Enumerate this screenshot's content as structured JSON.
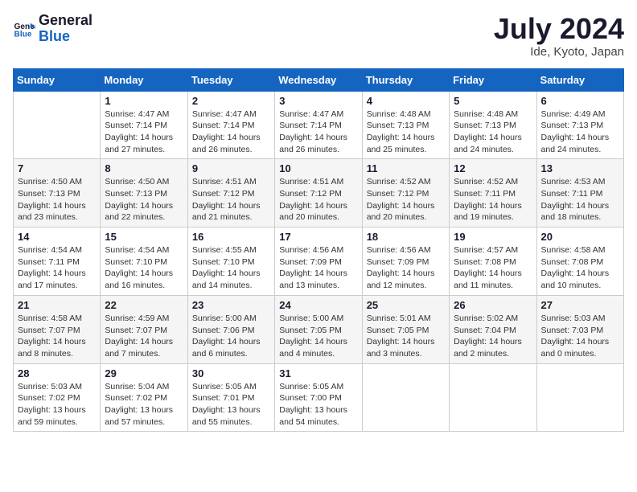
{
  "logo": {
    "line1": "General",
    "line2": "Blue"
  },
  "title": "July 2024",
  "location": "Ide, Kyoto, Japan",
  "header": {
    "days": [
      "Sunday",
      "Monday",
      "Tuesday",
      "Wednesday",
      "Thursday",
      "Friday",
      "Saturday"
    ]
  },
  "weeks": [
    [
      {
        "day": "",
        "info": ""
      },
      {
        "day": "1",
        "info": "Sunrise: 4:47 AM\nSunset: 7:14 PM\nDaylight: 14 hours\nand 27 minutes."
      },
      {
        "day": "2",
        "info": "Sunrise: 4:47 AM\nSunset: 7:14 PM\nDaylight: 14 hours\nand 26 minutes."
      },
      {
        "day": "3",
        "info": "Sunrise: 4:47 AM\nSunset: 7:14 PM\nDaylight: 14 hours\nand 26 minutes."
      },
      {
        "day": "4",
        "info": "Sunrise: 4:48 AM\nSunset: 7:13 PM\nDaylight: 14 hours\nand 25 minutes."
      },
      {
        "day": "5",
        "info": "Sunrise: 4:48 AM\nSunset: 7:13 PM\nDaylight: 14 hours\nand 24 minutes."
      },
      {
        "day": "6",
        "info": "Sunrise: 4:49 AM\nSunset: 7:13 PM\nDaylight: 14 hours\nand 24 minutes."
      }
    ],
    [
      {
        "day": "7",
        "info": "Sunrise: 4:50 AM\nSunset: 7:13 PM\nDaylight: 14 hours\nand 23 minutes."
      },
      {
        "day": "8",
        "info": "Sunrise: 4:50 AM\nSunset: 7:13 PM\nDaylight: 14 hours\nand 22 minutes."
      },
      {
        "day": "9",
        "info": "Sunrise: 4:51 AM\nSunset: 7:12 PM\nDaylight: 14 hours\nand 21 minutes."
      },
      {
        "day": "10",
        "info": "Sunrise: 4:51 AM\nSunset: 7:12 PM\nDaylight: 14 hours\nand 20 minutes."
      },
      {
        "day": "11",
        "info": "Sunrise: 4:52 AM\nSunset: 7:12 PM\nDaylight: 14 hours\nand 20 minutes."
      },
      {
        "day": "12",
        "info": "Sunrise: 4:52 AM\nSunset: 7:11 PM\nDaylight: 14 hours\nand 19 minutes."
      },
      {
        "day": "13",
        "info": "Sunrise: 4:53 AM\nSunset: 7:11 PM\nDaylight: 14 hours\nand 18 minutes."
      }
    ],
    [
      {
        "day": "14",
        "info": "Sunrise: 4:54 AM\nSunset: 7:11 PM\nDaylight: 14 hours\nand 17 minutes."
      },
      {
        "day": "15",
        "info": "Sunrise: 4:54 AM\nSunset: 7:10 PM\nDaylight: 14 hours\nand 16 minutes."
      },
      {
        "day": "16",
        "info": "Sunrise: 4:55 AM\nSunset: 7:10 PM\nDaylight: 14 hours\nand 14 minutes."
      },
      {
        "day": "17",
        "info": "Sunrise: 4:56 AM\nSunset: 7:09 PM\nDaylight: 14 hours\nand 13 minutes."
      },
      {
        "day": "18",
        "info": "Sunrise: 4:56 AM\nSunset: 7:09 PM\nDaylight: 14 hours\nand 12 minutes."
      },
      {
        "day": "19",
        "info": "Sunrise: 4:57 AM\nSunset: 7:08 PM\nDaylight: 14 hours\nand 11 minutes."
      },
      {
        "day": "20",
        "info": "Sunrise: 4:58 AM\nSunset: 7:08 PM\nDaylight: 14 hours\nand 10 minutes."
      }
    ],
    [
      {
        "day": "21",
        "info": "Sunrise: 4:58 AM\nSunset: 7:07 PM\nDaylight: 14 hours\nand 8 minutes."
      },
      {
        "day": "22",
        "info": "Sunrise: 4:59 AM\nSunset: 7:07 PM\nDaylight: 14 hours\nand 7 minutes."
      },
      {
        "day": "23",
        "info": "Sunrise: 5:00 AM\nSunset: 7:06 PM\nDaylight: 14 hours\nand 6 minutes."
      },
      {
        "day": "24",
        "info": "Sunrise: 5:00 AM\nSunset: 7:05 PM\nDaylight: 14 hours\nand 4 minutes."
      },
      {
        "day": "25",
        "info": "Sunrise: 5:01 AM\nSunset: 7:05 PM\nDaylight: 14 hours\nand 3 minutes."
      },
      {
        "day": "26",
        "info": "Sunrise: 5:02 AM\nSunset: 7:04 PM\nDaylight: 14 hours\nand 2 minutes."
      },
      {
        "day": "27",
        "info": "Sunrise: 5:03 AM\nSunset: 7:03 PM\nDaylight: 14 hours\nand 0 minutes."
      }
    ],
    [
      {
        "day": "28",
        "info": "Sunrise: 5:03 AM\nSunset: 7:02 PM\nDaylight: 13 hours\nand 59 minutes."
      },
      {
        "day": "29",
        "info": "Sunrise: 5:04 AM\nSunset: 7:02 PM\nDaylight: 13 hours\nand 57 minutes."
      },
      {
        "day": "30",
        "info": "Sunrise: 5:05 AM\nSunset: 7:01 PM\nDaylight: 13 hours\nand 55 minutes."
      },
      {
        "day": "31",
        "info": "Sunrise: 5:05 AM\nSunset: 7:00 PM\nDaylight: 13 hours\nand 54 minutes."
      },
      {
        "day": "",
        "info": ""
      },
      {
        "day": "",
        "info": ""
      },
      {
        "day": "",
        "info": ""
      }
    ]
  ]
}
